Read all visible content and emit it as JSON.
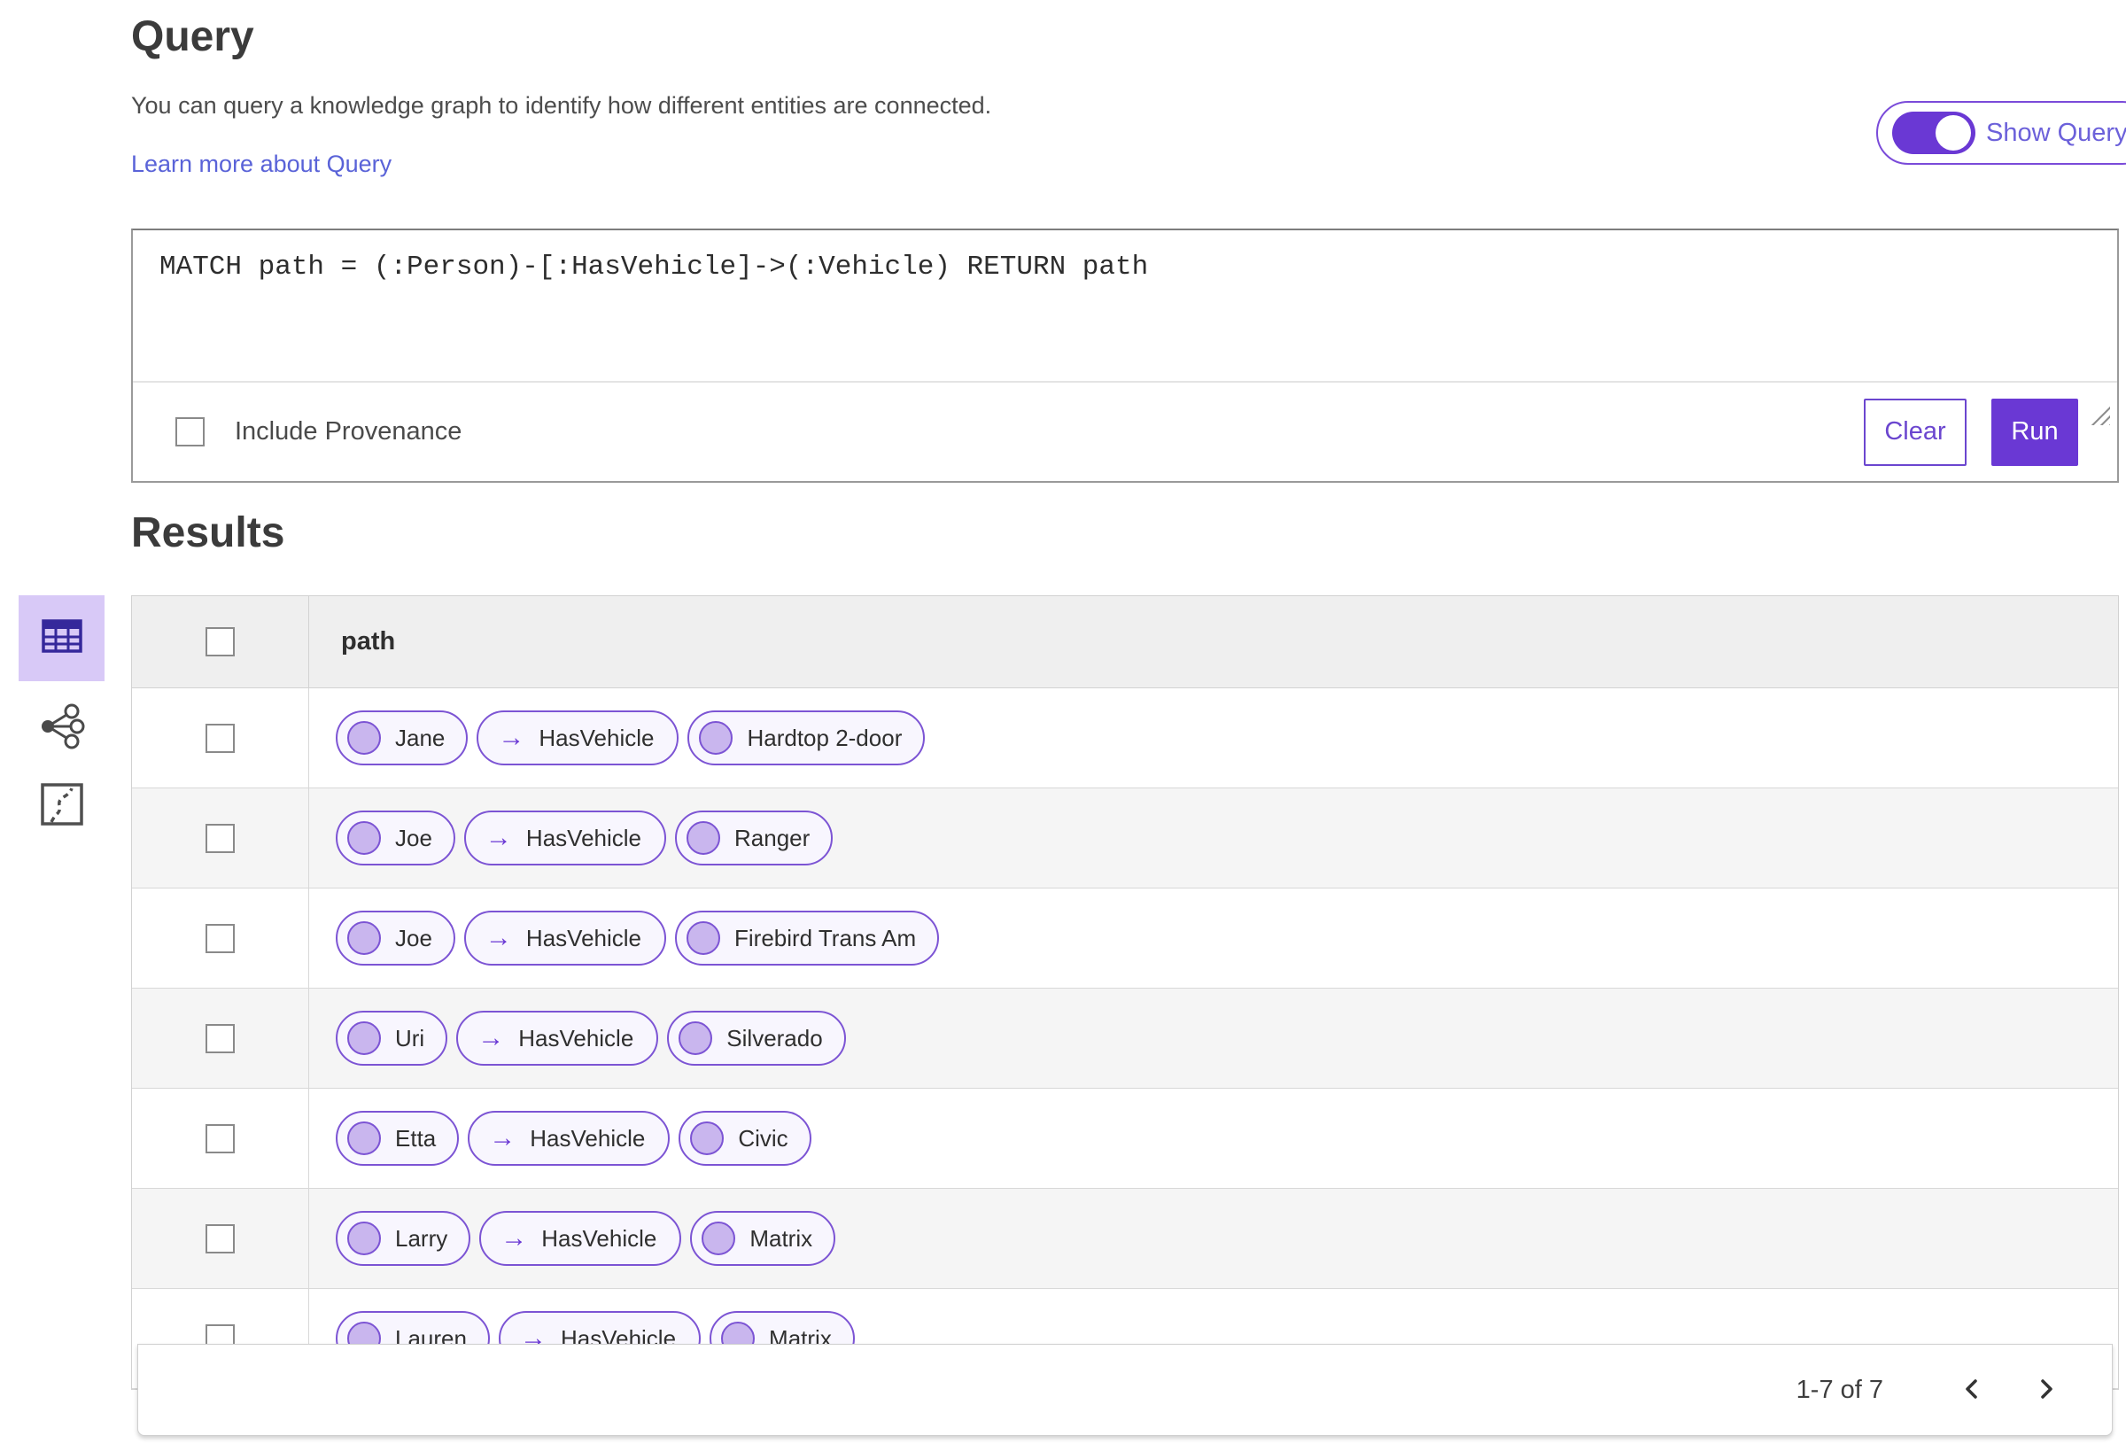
{
  "header": {
    "title": "Query",
    "description": "You can query a knowledge graph to identify how different entities are connected.",
    "learn_more_link": "Learn more about Query",
    "show_query_label": "Show Query",
    "show_query_on": true
  },
  "query_editor": {
    "text": "MATCH path = (:Person)-[:HasVehicle]->(:Vehicle) RETURN path",
    "include_provenance_label": "Include Provenance",
    "include_provenance_checked": false,
    "clear_label": "Clear",
    "run_label": "Run"
  },
  "results": {
    "heading": "Results",
    "column_header": "path",
    "arrow_glyph": "→",
    "view_switcher": {
      "selected": "table-view",
      "icons": [
        "table-view-icon",
        "link-chart-view-icon",
        "map-view-icon"
      ]
    },
    "rows": [
      {
        "source": "Jane",
        "relationship": "HasVehicle",
        "target": "Hardtop 2-door"
      },
      {
        "source": "Joe",
        "relationship": "HasVehicle",
        "target": "Ranger"
      },
      {
        "source": "Joe",
        "relationship": "HasVehicle",
        "target": "Firebird Trans Am"
      },
      {
        "source": "Uri",
        "relationship": "HasVehicle",
        "target": "Silverado"
      },
      {
        "source": "Etta",
        "relationship": "HasVehicle",
        "target": "Civic"
      },
      {
        "source": "Larry",
        "relationship": "HasVehicle",
        "target": "Matrix"
      },
      {
        "source": "Lauren",
        "relationship": "HasVehicle",
        "target": "Matrix"
      }
    ],
    "pagination": {
      "range_label": "1-7 of 7"
    }
  },
  "colors": {
    "accent_purple": "#6a38d4",
    "pill_border": "#7c54d4",
    "pill_background": "#f8f6fe",
    "node_fill": "#c9b6ee",
    "selected_view_background": "#d8c9f7",
    "link_color": "#5a63d8"
  }
}
